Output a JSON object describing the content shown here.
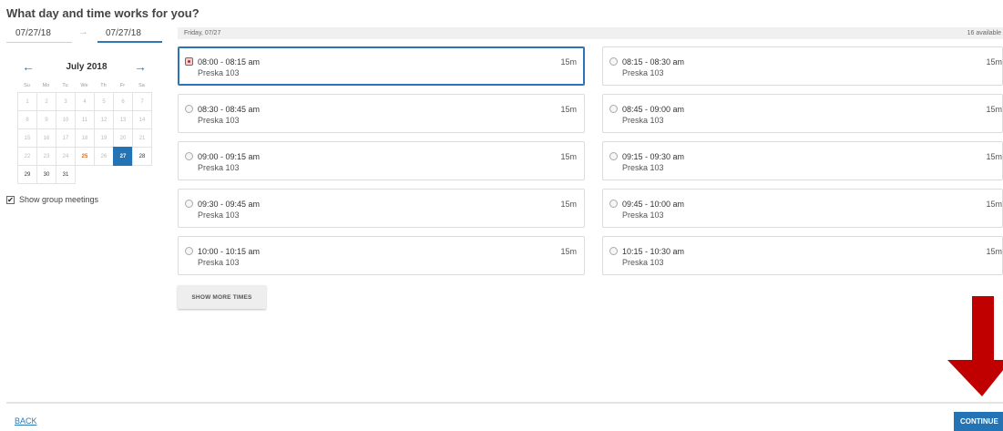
{
  "question": "What day and time works for you?",
  "date_range": {
    "start": "07/27/18",
    "end": "07/27/18",
    "arrow": "→"
  },
  "calendar": {
    "prev": "←",
    "next": "→",
    "month": "July 2018",
    "weekdays": [
      "Su",
      "Mo",
      "Tu",
      "We",
      "Th",
      "Fr",
      "Sa"
    ],
    "days": [
      {
        "d": "1",
        "s": "past"
      },
      {
        "d": "2",
        "s": "past"
      },
      {
        "d": "3",
        "s": "past"
      },
      {
        "d": "4",
        "s": "past"
      },
      {
        "d": "5",
        "s": "past"
      },
      {
        "d": "6",
        "s": "past"
      },
      {
        "d": "7",
        "s": "past"
      },
      {
        "d": "8",
        "s": "past"
      },
      {
        "d": "9",
        "s": "past"
      },
      {
        "d": "10",
        "s": "past"
      },
      {
        "d": "11",
        "s": "past"
      },
      {
        "d": "12",
        "s": "past"
      },
      {
        "d": "13",
        "s": "past"
      },
      {
        "d": "14",
        "s": "past"
      },
      {
        "d": "15",
        "s": "past"
      },
      {
        "d": "16",
        "s": "past"
      },
      {
        "d": "17",
        "s": "past"
      },
      {
        "d": "18",
        "s": "past"
      },
      {
        "d": "19",
        "s": "past"
      },
      {
        "d": "20",
        "s": "past"
      },
      {
        "d": "21",
        "s": "past"
      },
      {
        "d": "22",
        "s": "past"
      },
      {
        "d": "23",
        "s": "past"
      },
      {
        "d": "24",
        "s": "past"
      },
      {
        "d": "25",
        "s": "today"
      },
      {
        "d": "26",
        "s": "past"
      },
      {
        "d": "27",
        "s": "selected"
      },
      {
        "d": "28",
        "s": "dark"
      },
      {
        "d": "29",
        "s": "dark"
      },
      {
        "d": "30",
        "s": "dark"
      },
      {
        "d": "31",
        "s": "dark"
      }
    ]
  },
  "group_meetings": {
    "checked": true,
    "check_mark": "✔",
    "label": "Show group meetings"
  },
  "slots_header": {
    "date": "Friday, 07/27",
    "available": "16 available"
  },
  "slots": [
    {
      "time": "08:00 - 08:15 am",
      "room": "Preska 103",
      "duration": "15m",
      "selected": true
    },
    {
      "time": "08:15 - 08:30 am",
      "room": "Preska 103",
      "duration": "15m",
      "selected": false
    },
    {
      "time": "08:30 - 08:45 am",
      "room": "Preska 103",
      "duration": "15m",
      "selected": false
    },
    {
      "time": "08:45 - 09:00 am",
      "room": "Preska 103",
      "duration": "15m",
      "selected": false
    },
    {
      "time": "09:00 - 09:15 am",
      "room": "Preska 103",
      "duration": "15m",
      "selected": false
    },
    {
      "time": "09:15 - 09:30 am",
      "room": "Preska 103",
      "duration": "15m",
      "selected": false
    },
    {
      "time": "09:30 - 09:45 am",
      "room": "Preska 103",
      "duration": "15m",
      "selected": false
    },
    {
      "time": "09:45 - 10:00 am",
      "room": "Preska 103",
      "duration": "15m",
      "selected": false
    },
    {
      "time": "10:00 - 10:15 am",
      "room": "Preska 103",
      "duration": "15m",
      "selected": false
    },
    {
      "time": "10:15 - 10:30 am",
      "room": "Preska 103",
      "duration": "15m",
      "selected": false
    }
  ],
  "show_more_label": "SHOW MORE TIMES",
  "footer": {
    "back_label": "BACK",
    "continue_label": "CONTINUE"
  },
  "colors": {
    "accent": "#2473b5",
    "today": "#e06d1c",
    "annotation_arrow": "#c00000"
  },
  "annotation": {
    "icon": "red-down-arrow"
  }
}
